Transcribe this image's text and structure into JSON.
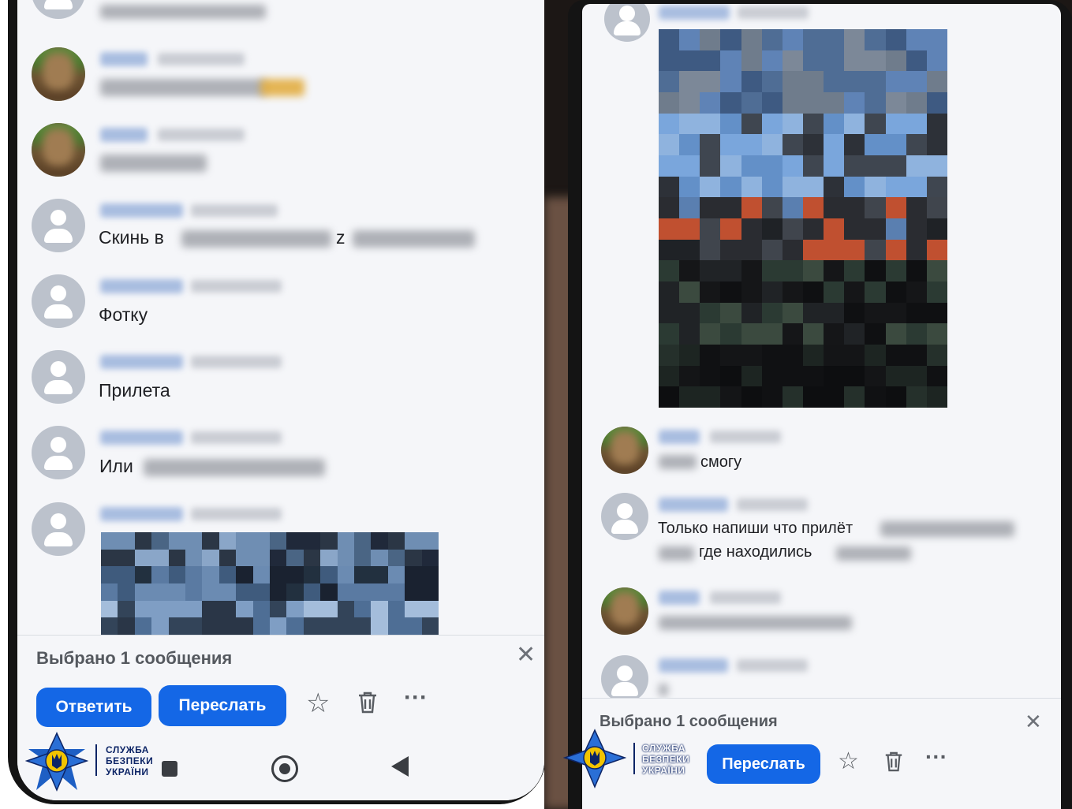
{
  "left_screen": {
    "messages": [
      {
        "text_before": "Скинь в",
        "text_after": "z"
      },
      {
        "text": "Фотку"
      },
      {
        "text": "Прилета"
      },
      {
        "text": "Или"
      }
    ],
    "selection_bar": {
      "label": "Выбрано 1 сообщения",
      "close_icon": "close-icon"
    },
    "actions": {
      "reply": "Ответить",
      "forward": "Переслать",
      "star_icon": "star-icon",
      "delete_icon": "trash-icon",
      "more_icon": "more-icon"
    },
    "watermark": {
      "lines": [
        "СЛУЖБА",
        "БЕЗПЕКИ",
        "УКРАЇНИ"
      ]
    }
  },
  "right_screen": {
    "messages": [
      {
        "text": "смогу"
      },
      {
        "text_line1": "Только напиши что прилёт",
        "text_line2": "где находились"
      }
    ],
    "selection_bar": {
      "label": "Выбрано 1 сообщения",
      "close_icon": "close-icon"
    },
    "actions": {
      "forward": "Переслать",
      "star_icon": "star-icon",
      "delete_icon": "trash-icon",
      "more_icon": "more-icon"
    },
    "watermark": {
      "lines": [
        "СЛУЖБА",
        "БЕЗПЕКИ",
        "УКРАЇНИ"
      ]
    }
  },
  "colors": {
    "accent": "#1467e6",
    "screen_bg": "#f5f6f9",
    "avatar_placeholder": "#bcc2cc"
  }
}
